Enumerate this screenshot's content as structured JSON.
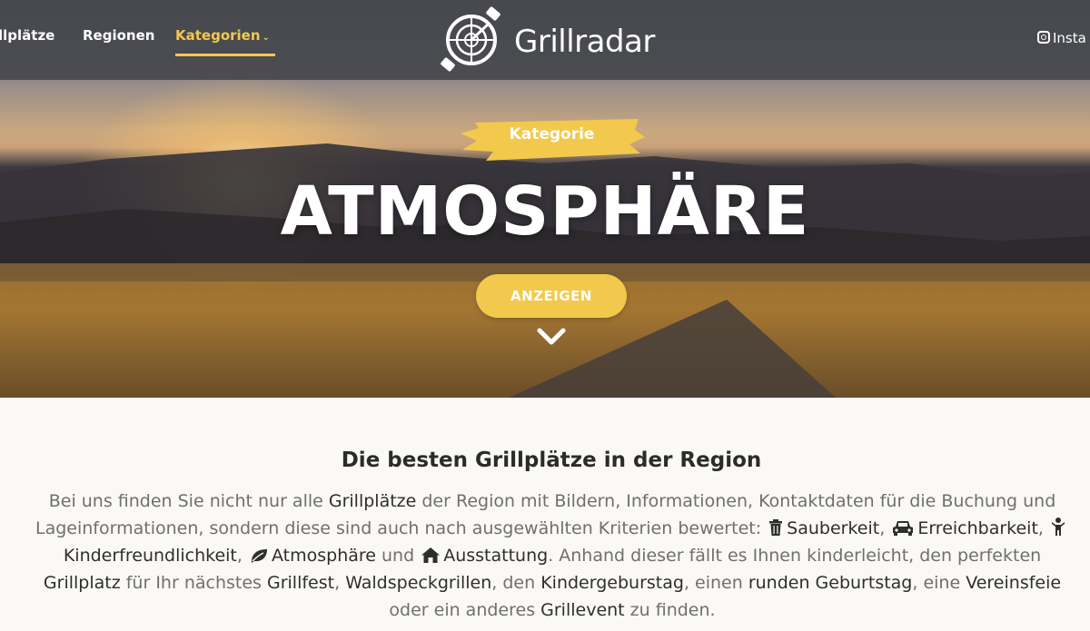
{
  "nav": {
    "links": [
      "llplätze",
      "Regionen",
      "Kategorien"
    ],
    "brand": "Grillradar",
    "social_label": "Insta"
  },
  "hero": {
    "badge": "Kategorie",
    "title": "ATMOSPHÄRE",
    "cta": "ANZEIGEN"
  },
  "content": {
    "heading": "Die besten Grillplätze in der Region",
    "l1a": "Bei uns finden Sie nicht nur alle ",
    "l1b": "Grillplätze",
    "l1c": " der Region mit Bildern, Informationen, Kontaktdaten für die Buchung und",
    "l2a": "Lageinformationen, sondern diese sind auch nach ausgewählten Kriterien bewertet: ",
    "l2b": "Sauberkeit",
    "l2c": ", ",
    "l2d": "Erreichbarkeit",
    "l2e": ", ",
    "l3a": "Kinderfreundlichkeit",
    "l3b": ", ",
    "l3c": "Atmosphäre",
    "l3d": " und ",
    "l3e": "Ausstattung",
    "l3f": ". Anhand dieser fällt es Ihnen kinderleicht, den perfekten",
    "l4a": "Grillplatz",
    "l4b": " für Ihr nächstes ",
    "l4c": "Grillfest",
    "l4d": ", ",
    "l4e": "Waldspeckgrillen",
    "l4f": ", den ",
    "l4g": "Kindergeburstag",
    "l4h": ", einen ",
    "l4i": "runden Geburtstag",
    "l4j": ", eine ",
    "l4k": "Vereinsfeie",
    "l5a": "oder ein anderes ",
    "l5b": "Grillevent",
    "l5c": " zu finden."
  },
  "colors": {
    "accent": "#f2c94c",
    "nav_bg": "#46484c",
    "page_bg": "#fbf9f6"
  },
  "icons": [
    "logo-radar-icon",
    "instagram-icon",
    "chevron-down-icon",
    "trash-icon",
    "car-icon",
    "child-icon",
    "leaf-icon",
    "home-icon"
  ]
}
